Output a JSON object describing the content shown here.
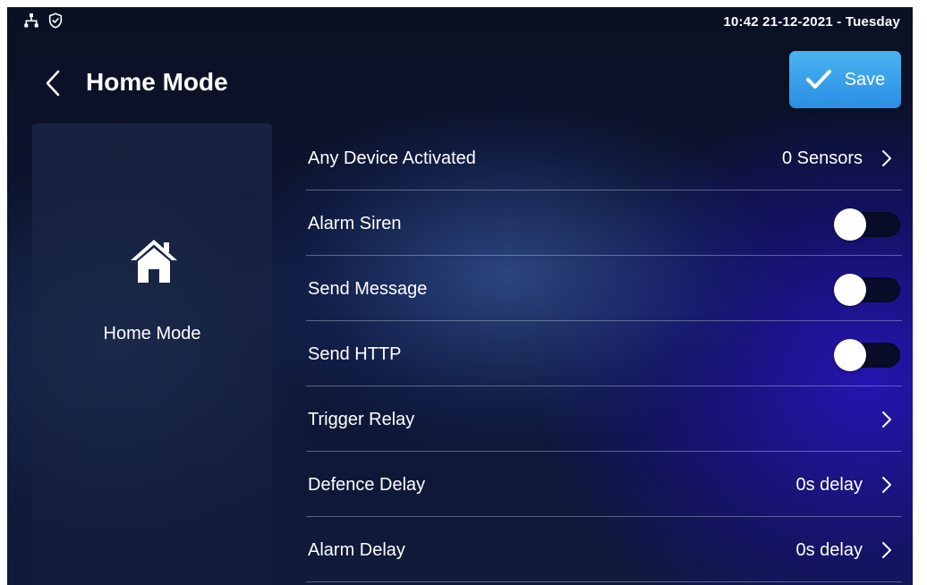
{
  "status_bar": {
    "network_icon": "network-tree-icon",
    "security_icon": "shield-check-icon",
    "clock": "10:42  21-12-2021 - Tuesday"
  },
  "header": {
    "back_icon": "chevron-left-icon",
    "title": "Home Mode",
    "save_icon": "checkmark-icon",
    "save_label": "Save"
  },
  "mode_panel": {
    "icon": "house-icon",
    "label": "Home Mode"
  },
  "settings": [
    {
      "label": "Any Device Activated",
      "value": "0 Sensors",
      "control": "chevron"
    },
    {
      "label": "Alarm Siren",
      "control": "toggle",
      "state": "off"
    },
    {
      "label": "Send Message",
      "control": "toggle",
      "state": "off"
    },
    {
      "label": "Send HTTP",
      "control": "toggle",
      "state": "off"
    },
    {
      "label": "Trigger Relay",
      "value": "",
      "control": "chevron"
    },
    {
      "label": "Defence Delay",
      "value": "0s delay",
      "control": "chevron"
    },
    {
      "label": "Alarm Delay",
      "value": "0s delay",
      "control": "chevron"
    }
  ],
  "colors": {
    "save_button": "#3aa3ec",
    "toggle_track": "#0a0d2a",
    "divider": "#d2dcf0"
  }
}
